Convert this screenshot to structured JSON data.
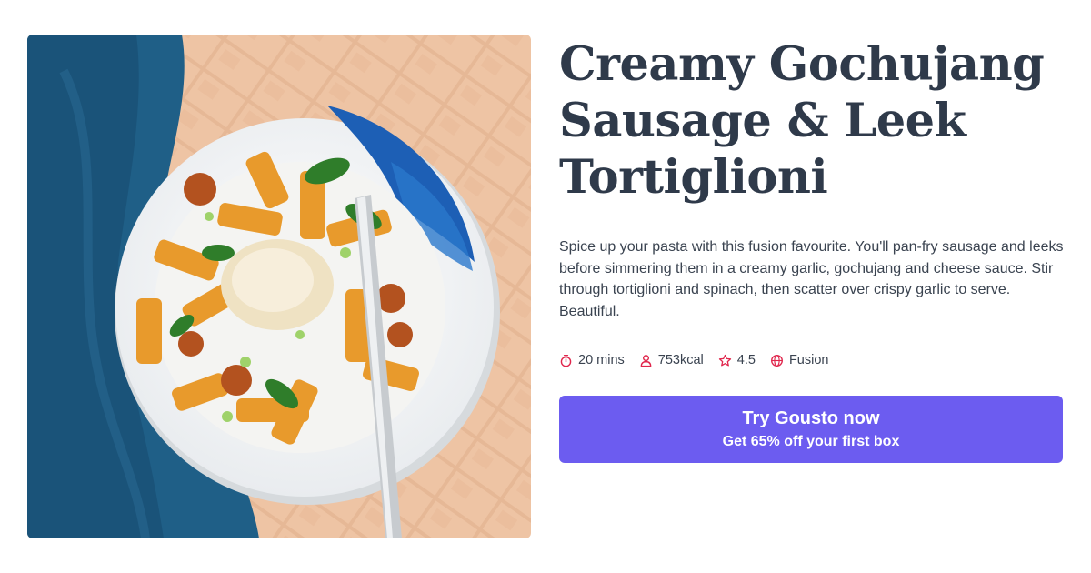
{
  "recipe": {
    "title_lines": [
      "Creamy Gochujang",
      "Sausage & Leek",
      "Tortiglioni"
    ],
    "description": "Spice up your pasta with this fusion favourite. You'll pan-fry sausage and leeks before simmering them in a creamy garlic, gochujang and cheese sauce. Stir through tortiglioni and spinach, then scatter over crispy garlic to serve. Beautiful.",
    "meta": {
      "time": "20 mins",
      "calories": "753kcal",
      "rating": "4.5",
      "cuisine": "Fusion"
    }
  },
  "cta": {
    "title": "Try Gousto now",
    "subtitle": "Get 65% off your first box"
  },
  "colors": {
    "accent": "#6c5cf0",
    "icon": "#e0264c",
    "text": "#2f3a4a"
  },
  "icons": {
    "time": "stopwatch-icon",
    "calories": "person-icon",
    "rating": "star-icon",
    "cuisine": "globe-icon"
  }
}
